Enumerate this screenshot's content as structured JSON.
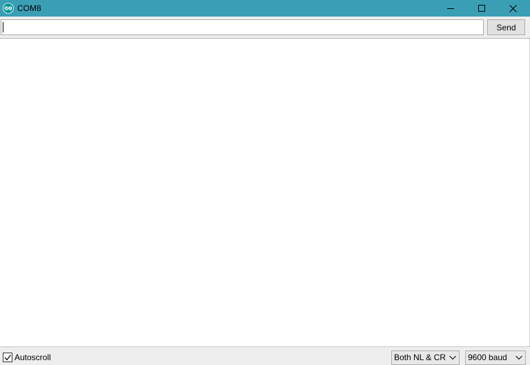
{
  "window": {
    "title": "COM8",
    "app_icon": "arduino-icon",
    "controls": [
      "minimize-icon",
      "maximize-icon",
      "close-icon"
    ]
  },
  "input": {
    "value": "",
    "send_label": "Send"
  },
  "output": {
    "lines": []
  },
  "statusbar": {
    "autoscroll_label": "Autoscroll",
    "autoscroll_checked": true,
    "line_ending": "Both NL & CR",
    "baud_rate": "9600 baud"
  },
  "colors": {
    "titlebar": "#3a9fb5",
    "chrome": "#eeeeee",
    "button": "#e1e1e1"
  }
}
